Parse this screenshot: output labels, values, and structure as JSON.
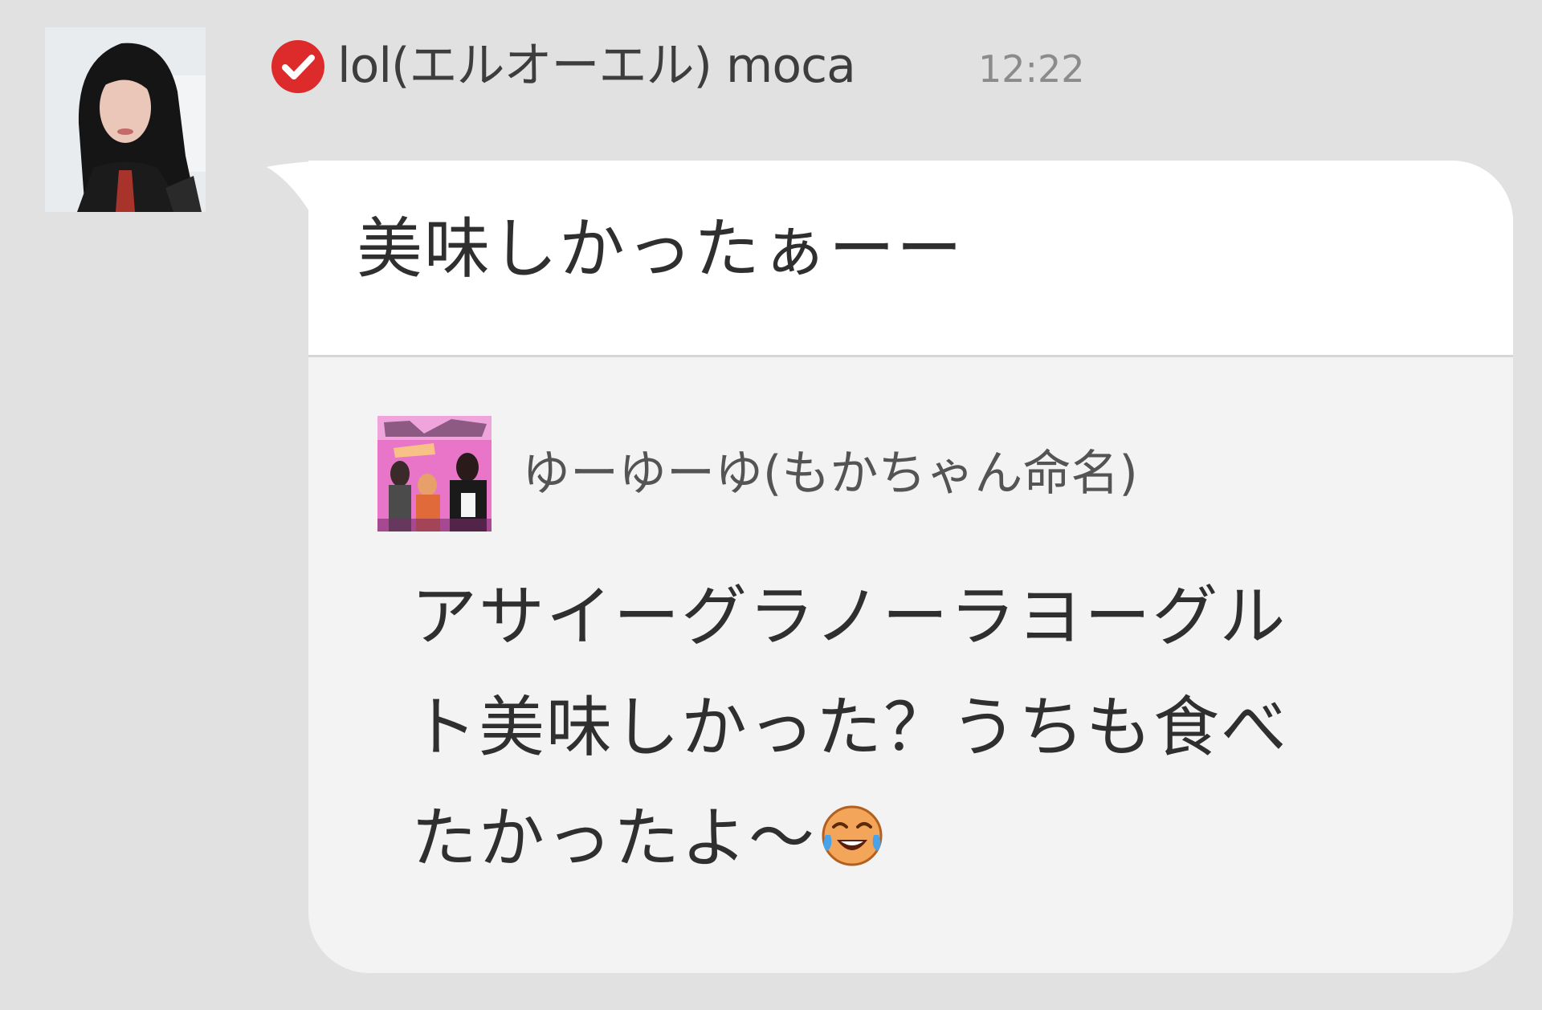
{
  "message": {
    "sender": {
      "name": "lol(エルオーエル) moca",
      "avatar_icon": "profile-photo",
      "verified_icon": "verified-check-icon",
      "verified_color": "#dd2a2a"
    },
    "time": "12:22",
    "text": "美味しかったぁーー",
    "quote": {
      "author": "ゆーゆーゆ(もかちゃん命名)",
      "avatar_icon": "moca-lol-thumbnail",
      "lines": [
        "アサイーグラノーラヨーグル",
        "ト美味しかった？うちも食べ",
        "たかったよ〜"
      ],
      "emoji_icon": "crying-laughing-emoji"
    }
  },
  "colors": {
    "background": "#e1e1e1",
    "bubble_top": "#ffffff",
    "bubble_quote": "#f3f3f3",
    "text": "#2f2f2f",
    "time": "#8b8b8b"
  }
}
